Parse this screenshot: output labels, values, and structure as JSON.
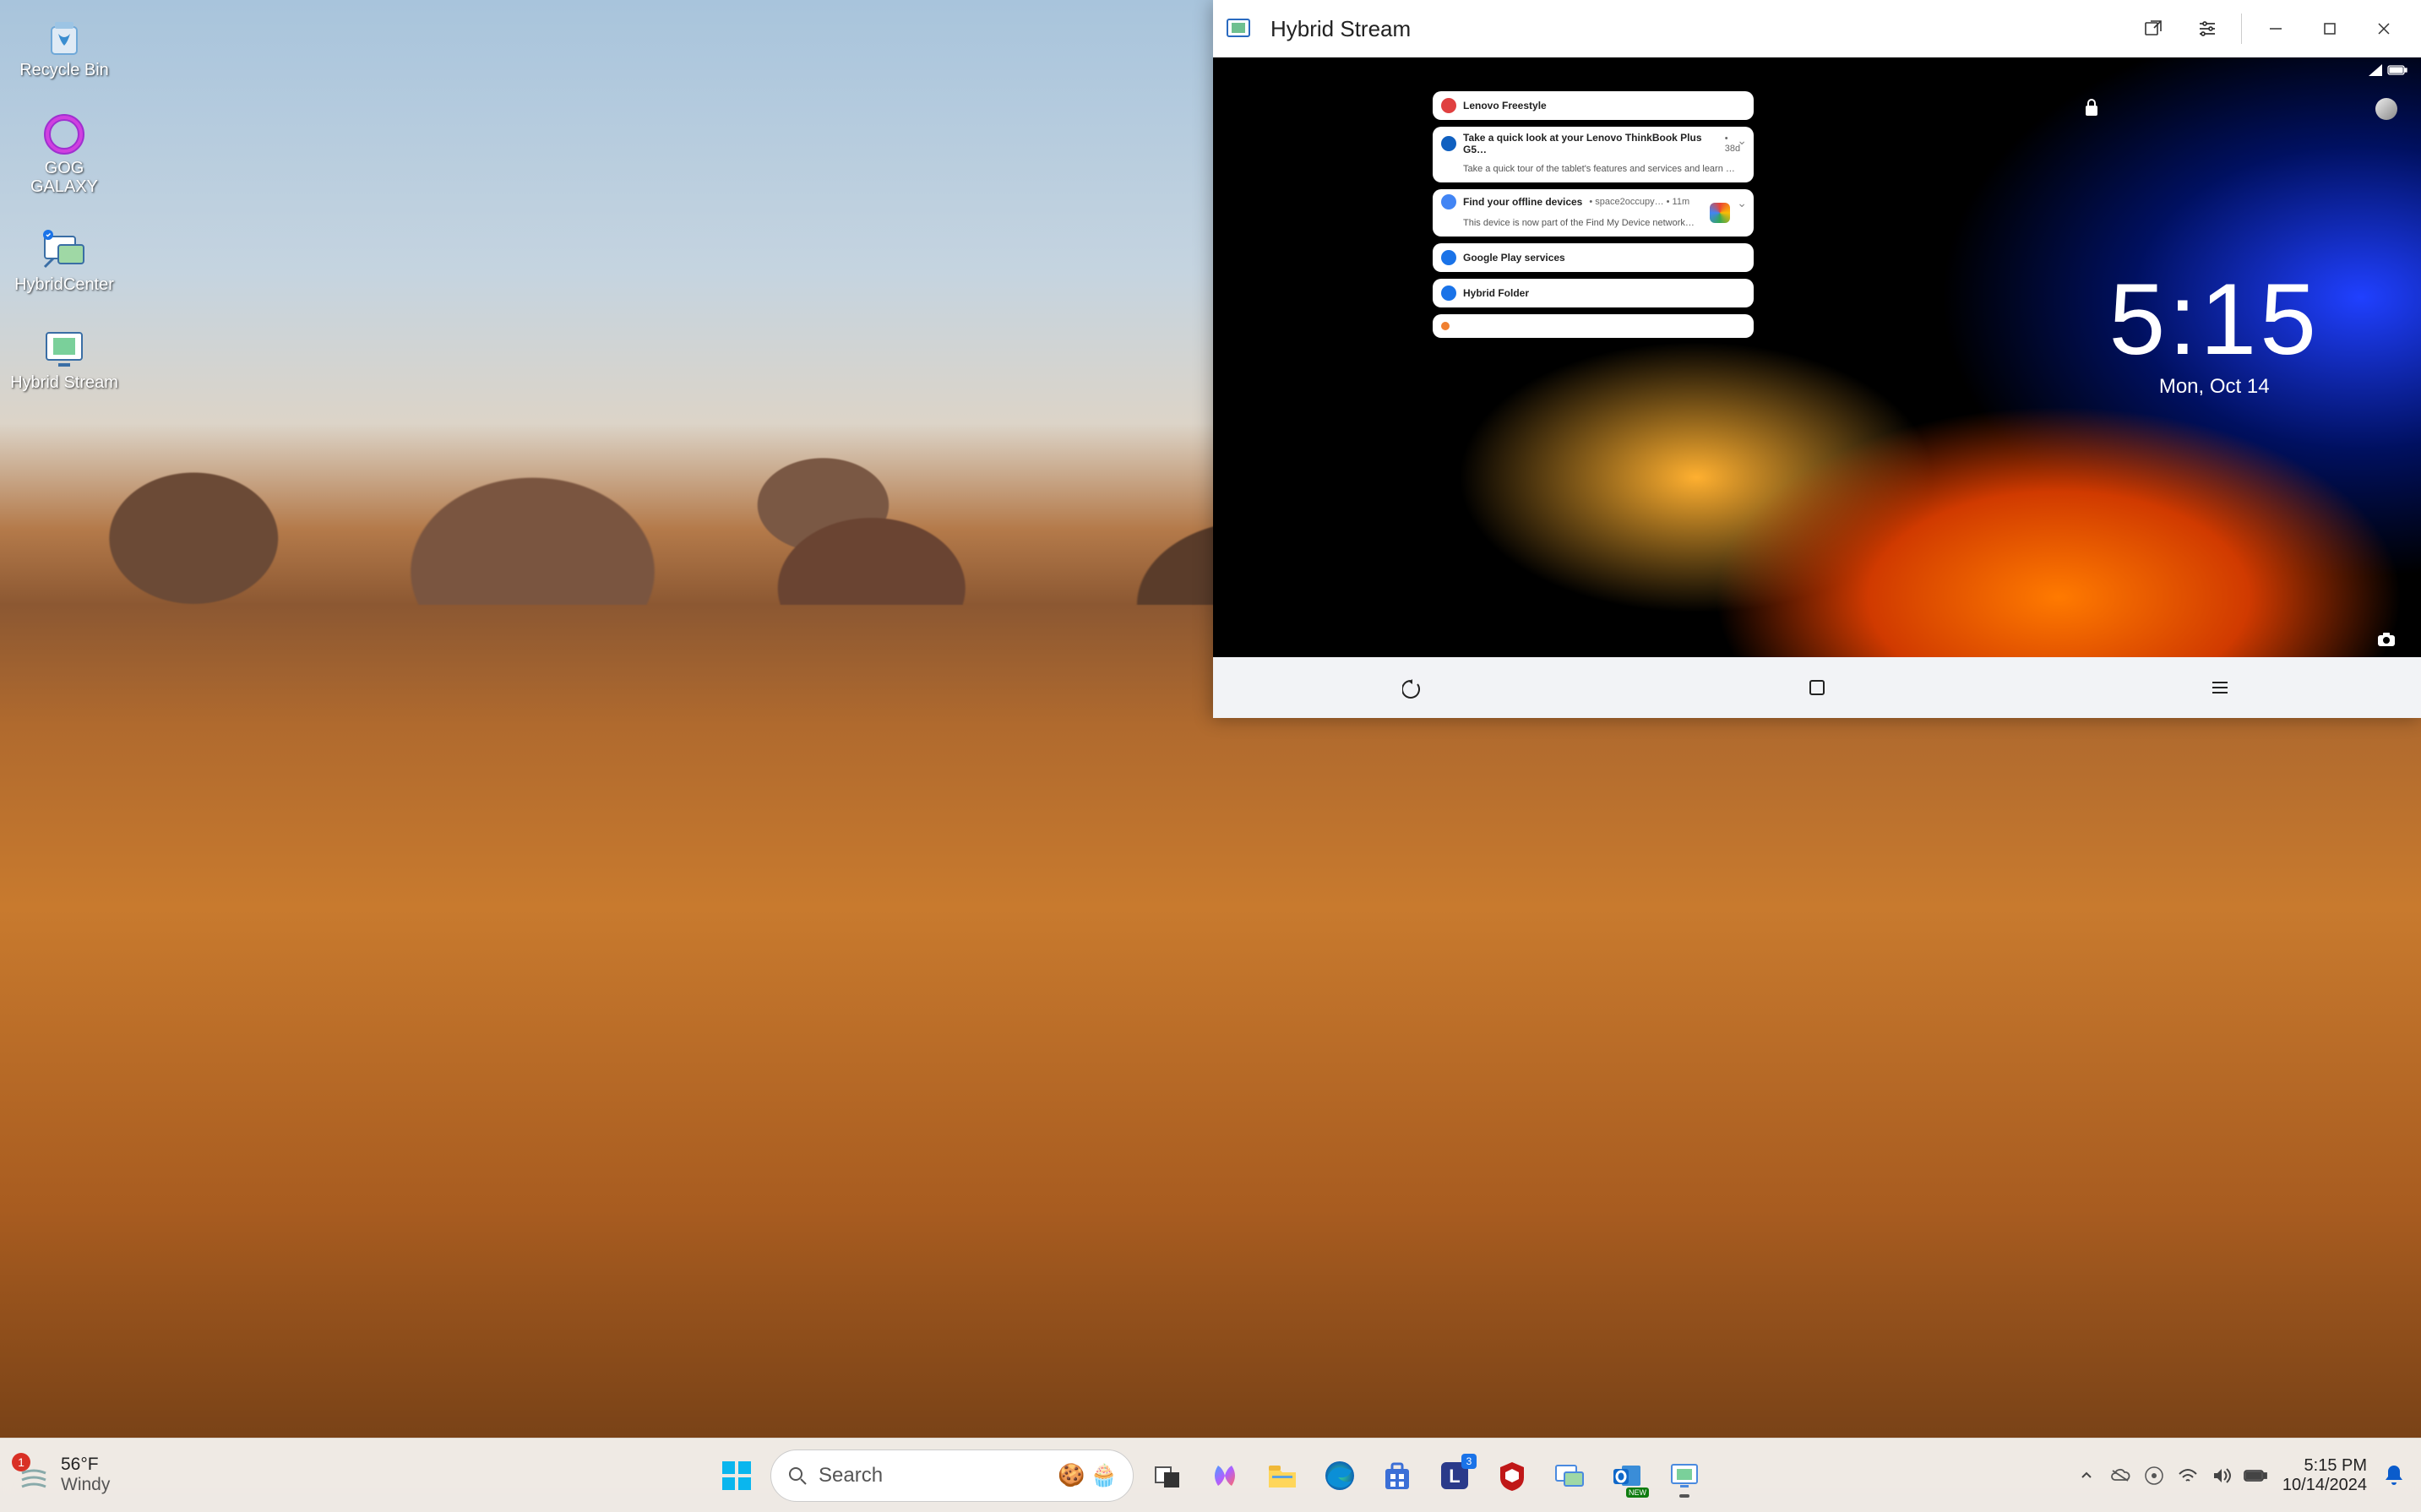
{
  "desktop": {
    "icons": [
      {
        "name": "recycle-bin",
        "label": "Recycle Bin"
      },
      {
        "name": "gog-galaxy",
        "label": "GOG GALAXY"
      },
      {
        "name": "hybrid-center",
        "label": "HybridCenter"
      },
      {
        "name": "hybrid-stream",
        "label": "Hybrid Stream"
      }
    ]
  },
  "window": {
    "title": "Hybrid Stream",
    "android": {
      "time": "5:15",
      "date": "Mon, Oct 14",
      "notifications": [
        {
          "app": "Lenovo Freestyle",
          "title": "Lenovo Freestyle",
          "icon_color": "#e04040"
        },
        {
          "app": "Lenovo",
          "title": "Take a quick look at your Lenovo ThinkBook Plus G5…",
          "meta": "• 38d",
          "body": "Take a quick tour of the tablet's features and services and learn …",
          "icon_color": "#1060c0",
          "expandable": true
        },
        {
          "app": "Google",
          "title": "Find your offline devices",
          "meta": "• space2occupy… • 11m",
          "body": "This device is now part of the Find My Device network…",
          "icon_color": "#4285f4",
          "right_icon": true,
          "expandable": true
        },
        {
          "app": "Google Play services",
          "title": "Google Play services",
          "icon_color": "#1a73e8"
        },
        {
          "app": "Hybrid Folder",
          "title": "Hybrid Folder",
          "icon_color": "#1a73e8"
        },
        {
          "app": "",
          "title": "·",
          "icon_color": "#f08030"
        }
      ]
    }
  },
  "taskbar": {
    "weather": {
      "temp": "56°F",
      "condition": "Windy",
      "badge": "1"
    },
    "search_placeholder": "Search",
    "apps": [
      {
        "name": "task-view",
        "color": "#555"
      },
      {
        "name": "copilot",
        "color": "#7b61ff"
      },
      {
        "name": "file-explorer",
        "color": "#f8c24a"
      },
      {
        "name": "edge",
        "color": "#0b8fd6"
      },
      {
        "name": "microsoft-store",
        "color": "#3b6fd6"
      },
      {
        "name": "lenovo",
        "color": "#2a3a8a",
        "badge": "3"
      },
      {
        "name": "mcafee",
        "color": "#c01818"
      },
      {
        "name": "hybrid-center",
        "color": "#4a8adf"
      },
      {
        "name": "outlook",
        "color": "#1068c9",
        "new": true
      },
      {
        "name": "hybrid-stream",
        "color": "#4a8adf",
        "active": true
      }
    ],
    "tray": {
      "time": "5:15 PM",
      "date": "10/14/2024"
    }
  }
}
